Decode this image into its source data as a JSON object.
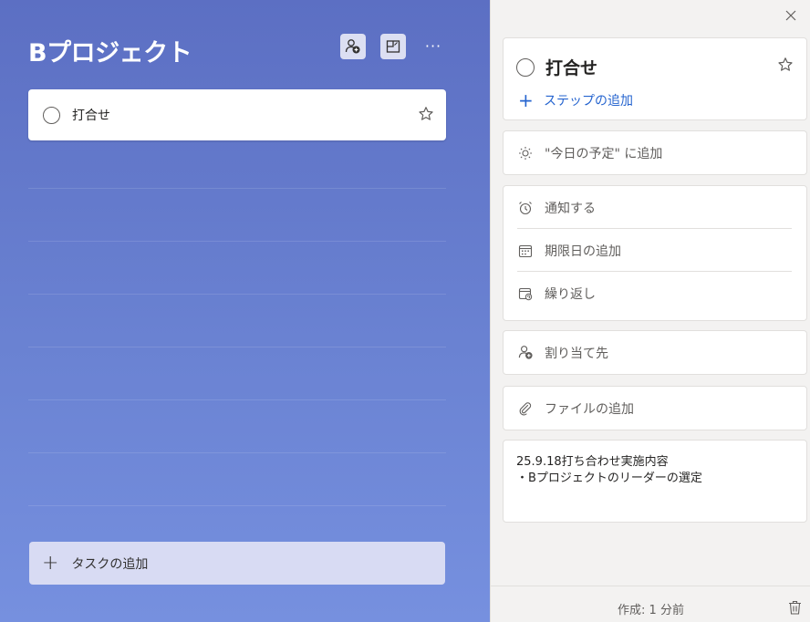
{
  "list": {
    "title": "Bプロジェクト",
    "tasks": [
      {
        "title": "打合せ",
        "completed": false,
        "important": false
      }
    ],
    "add_task_label": "タスクの追加",
    "toolbar_icons": [
      "assign-user-icon",
      "layout-icon",
      "more-icon"
    ]
  },
  "detail": {
    "task_title": "打合せ",
    "add_step_label": "ステップの追加",
    "add_to_my_day_label": "\"今日の予定\" に追加",
    "remind_label": "通知する",
    "due_date_label": "期限日の追加",
    "repeat_label": "繰り返し",
    "assign_label": "割り当て先",
    "add_file_label": "ファイルの追加",
    "note": "25.9.18打ち合わせ実施内容\n・Bプロジェクトのリーダーの選定",
    "created_label": "作成: 1 分前"
  },
  "colors": {
    "accent": "#2564cf",
    "list_bg_top": "#5c6fc3",
    "list_bg_bottom": "#7690df",
    "add_task_bg": "#d8dbf3",
    "detail_bg": "#f3f2f1"
  }
}
